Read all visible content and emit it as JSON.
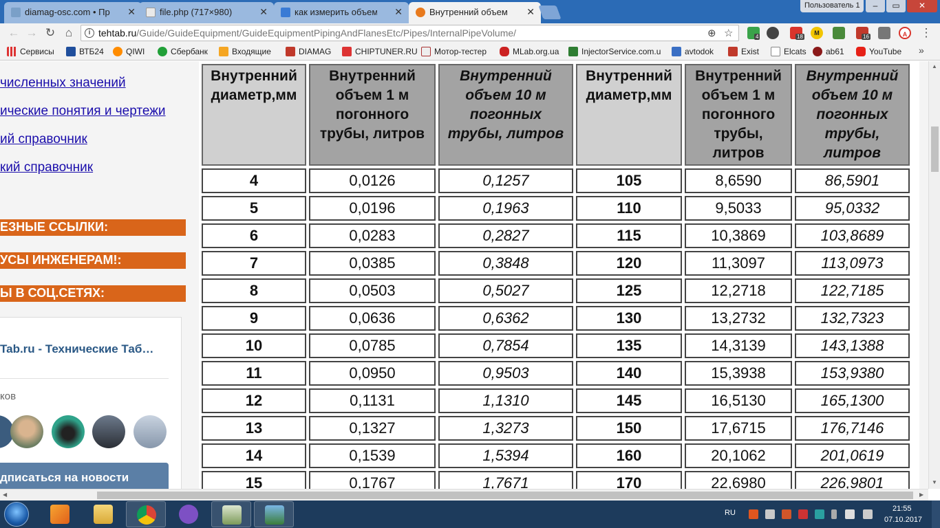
{
  "browser": {
    "tabs": [
      {
        "title": "diamag-osc.com • Прос",
        "favicon_color": "#7aa0c8"
      },
      {
        "title": "file.php (717×980)",
        "favicon_color": "#e9e9e9"
      },
      {
        "title": "как измерить объем тр",
        "favicon_color": "#3a7bd5"
      },
      {
        "title": "Внутренний объем пого",
        "favicon_color": "#e87a1d"
      }
    ],
    "profile": "Пользователь 1",
    "window_buttons": {
      "minimize": "–",
      "maximize": "▭",
      "close": "✕"
    },
    "url_host": "tehtab.ru",
    "url_path": "/Guide/GuideEquipment/GuideEquipmentPipingAndFlanesEtc/Pipes/InternalPipeVolume/",
    "extension_badges": {
      "green": "4",
      "red": "18",
      "gray": "16"
    },
    "bookmarks_apps": "Сервисы",
    "bookmarks": [
      "ВТБ24",
      "QIWI",
      "Сбербанк",
      "Входящие",
      "DIAMAG",
      "CHIPTUNER.RU",
      "Мотор-тестер",
      "MLab.org.ua",
      "InjectorService.com.u",
      "avtodok",
      "Exist",
      "Elcats",
      "ab61",
      "YouTube"
    ],
    "bookmarks_more": "»"
  },
  "sidebar": {
    "links": [
      "численных значений",
      "ические понятия и чертежи",
      "ий справочник",
      "кий справочник"
    ],
    "section_bars": [
      "ЕЗНЫЕ ССЫЛКИ:",
      "УСЫ ИНЖЕНЕРАМ!:",
      "Ы В СОЦ.СЕТЯХ:"
    ],
    "vk": {
      "title": "Tab.ru - Технические Таб…",
      "subscribers": "ков",
      "subscribe_button": "дписаться на новости"
    }
  },
  "table": {
    "headers": [
      "Внутренний диаметр,мм",
      "Внутренний объем 1 м погонного трубы, литров",
      "Внутренний объем 10 м погонных трубы, литров",
      "Внутренний диаметр,мм",
      "Внутренний объем 1 м погонного трубы, литров",
      "Внутренний объем 10 м погонных трубы, литров"
    ],
    "rows": [
      [
        "4",
        "0,0126",
        "0,1257",
        "105",
        "8,6590",
        "86,5901"
      ],
      [
        "5",
        "0,0196",
        "0,1963",
        "110",
        "9,5033",
        "95,0332"
      ],
      [
        "6",
        "0,0283",
        "0,2827",
        "115",
        "10,3869",
        "103,8689"
      ],
      [
        "7",
        "0,0385",
        "0,3848",
        "120",
        "11,3097",
        "113,0973"
      ],
      [
        "8",
        "0,0503",
        "0,5027",
        "125",
        "12,2718",
        "122,7185"
      ],
      [
        "9",
        "0,0636",
        "0,6362",
        "130",
        "13,2732",
        "132,7323"
      ],
      [
        "10",
        "0,0785",
        "0,7854",
        "135",
        "14,3139",
        "143,1388"
      ],
      [
        "11",
        "0,0950",
        "0,9503",
        "140",
        "15,3938",
        "153,9380"
      ],
      [
        "12",
        "0,1131",
        "1,1310",
        "145",
        "16,5130",
        "165,1300"
      ],
      [
        "13",
        "0,1327",
        "1,3273",
        "150",
        "17,6715",
        "176,7146"
      ],
      [
        "14",
        "0,1539",
        "1,5394",
        "160",
        "20,1062",
        "201,0619"
      ],
      [
        "15",
        "0,1767",
        "1,7671",
        "170",
        "22,6980",
        "226,9801"
      ]
    ]
  },
  "taskbar": {
    "language": "RU",
    "time": "21:55",
    "date": "07.10.2017"
  }
}
